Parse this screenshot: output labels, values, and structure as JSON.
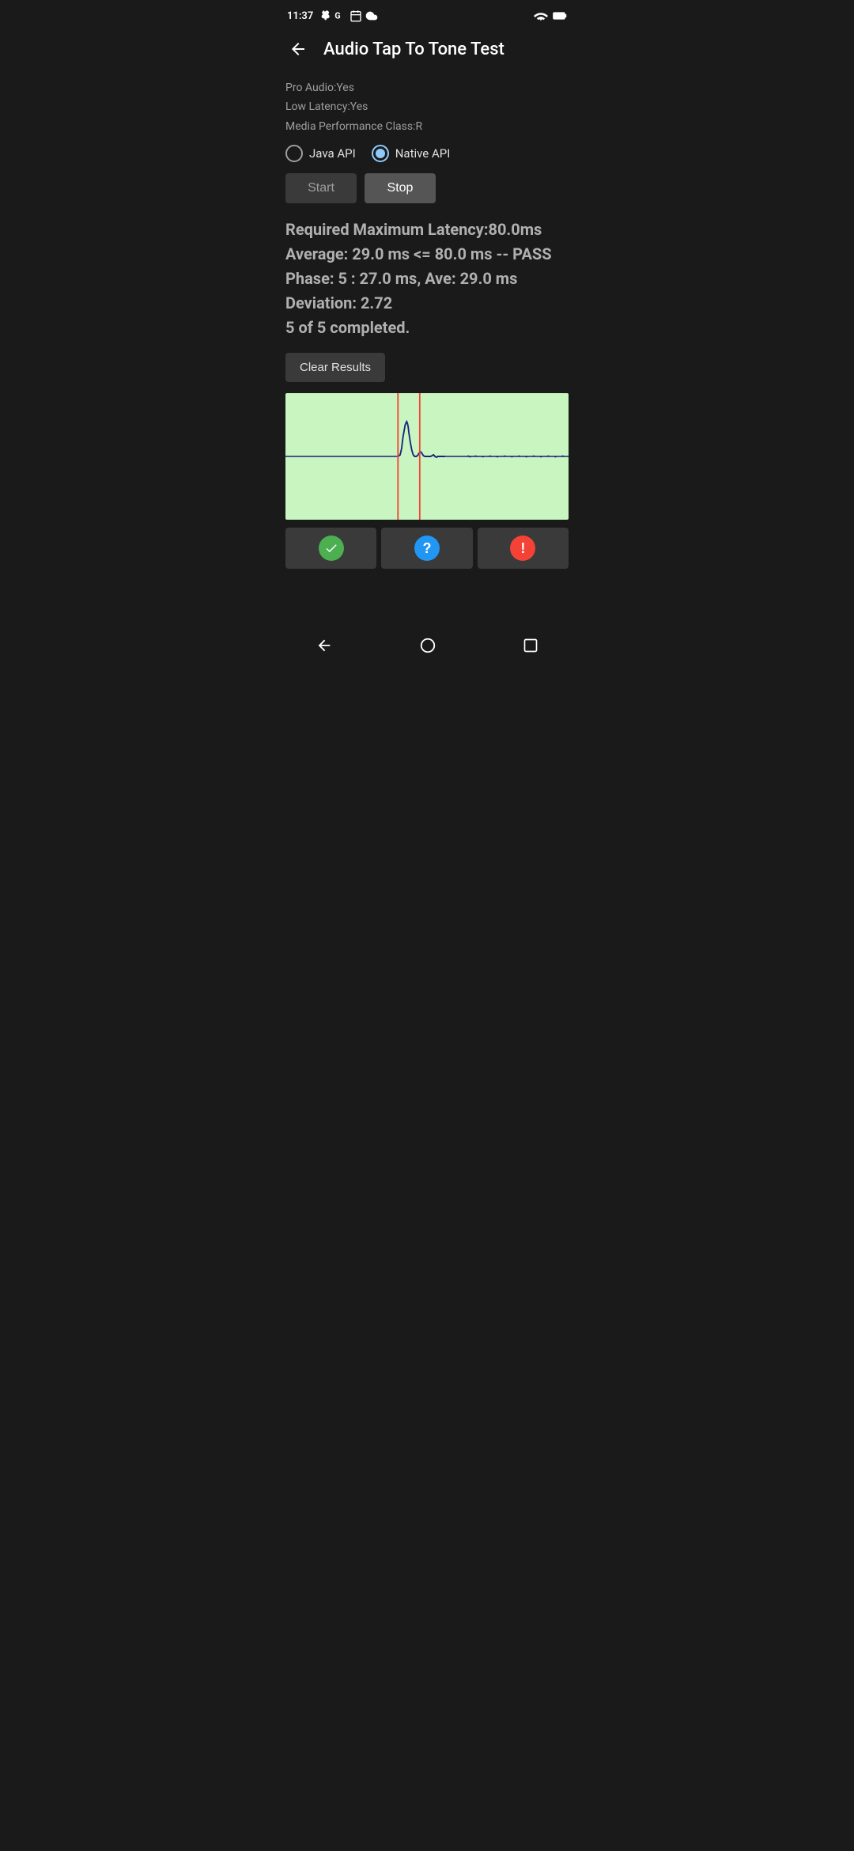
{
  "statusBar": {
    "time": "11:37",
    "icons": [
      "fan-icon",
      "google-icon",
      "calendar-icon",
      "cloud-icon",
      "wifi-icon",
      "battery-icon"
    ]
  },
  "appBar": {
    "title": "Audio Tap To Tone Test",
    "backLabel": "back"
  },
  "deviceInfo": {
    "proAudio": "Pro Audio:Yes",
    "lowLatency": "Low Latency:Yes",
    "mediaPerformance": "Media Performance Class:R"
  },
  "apiSelector": {
    "javaApi": "Java API",
    "nativeApi": "Native API",
    "selected": "native"
  },
  "buttons": {
    "start": "Start",
    "stop": "Stop"
  },
  "results": {
    "line1": "Required Maximum Latency:80.0ms",
    "line2": "Average: 29.0 ms <= 80.0 ms -- PASS",
    "line3": "Phase: 5 : 27.0 ms, Ave: 29.0 ms",
    "line4": "Deviation: 2.72",
    "line5": "5 of 5 completed."
  },
  "clearButton": "Clear Results",
  "actionButtons": {
    "pass": "✓",
    "question": "?",
    "warning": "!"
  },
  "waveform": {
    "backgroundColor": "#c8f5c0",
    "lineColor": "#1a237e",
    "redLineColor": "#f44336"
  }
}
